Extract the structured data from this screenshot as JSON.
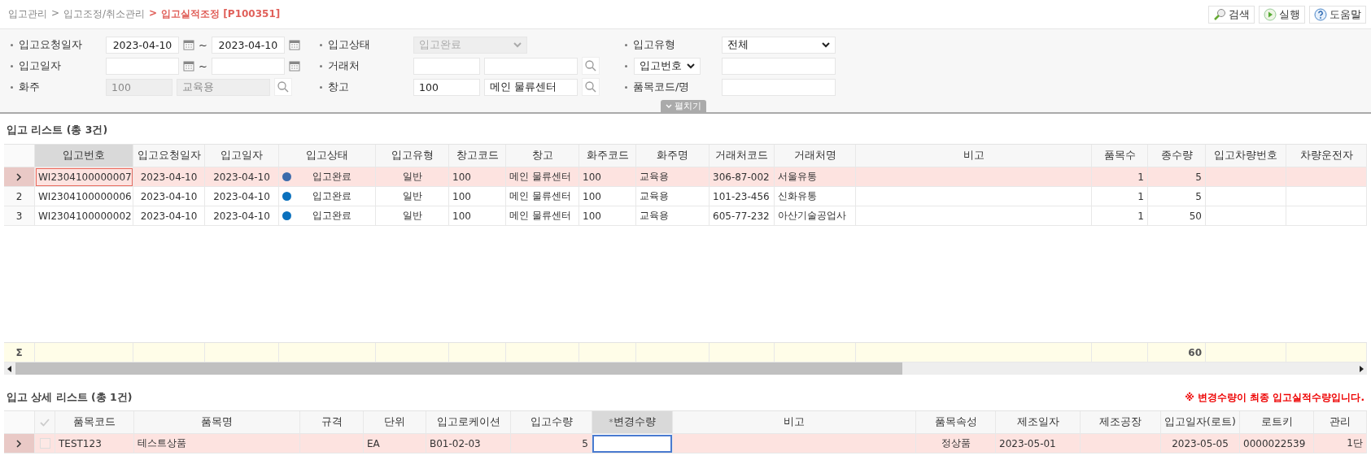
{
  "breadcrumb": {
    "separator": ">",
    "items": [
      {
        "label": "입고관리",
        "current": false
      },
      {
        "label": "입고조정/취소관리",
        "current": false
      },
      {
        "label": "입고실적조정 [P100351]",
        "current": true
      }
    ]
  },
  "toolbar": [
    {
      "kind": "search",
      "label": "검색"
    },
    {
      "kind": "run",
      "label": "실행"
    },
    {
      "kind": "help",
      "label": "도움말"
    }
  ],
  "filters": [
    [
      {
        "kind": "text",
        "label": "입고요청일자",
        "controls": [
          {
            "kind": "date",
            "value": "2023-04-10"
          },
          {
            "kind": "tilde",
            "text": "~"
          },
          {
            "kind": "date",
            "value": "2023-04-10"
          }
        ]
      },
      {
        "kind": "text",
        "label": "입고상태",
        "controls": [
          {
            "kind": "select",
            "value": "입고완료",
            "disabled": true
          }
        ]
      },
      {
        "kind": "text",
        "label": "입고유형",
        "controls": [
          {
            "kind": "select",
            "value": "전체",
            "disabled": false
          }
        ]
      }
    ],
    [
      {
        "kind": "text",
        "label": "입고일자",
        "controls": [
          {
            "kind": "date"
          },
          {
            "kind": "tilde",
            "text": "~"
          },
          {
            "kind": "date"
          }
        ]
      },
      {
        "kind": "text",
        "label": "거래처",
        "controls": [
          {
            "kind": "code-input",
            "disabled": false
          },
          {
            "kind": "name-input",
            "disabled": false
          },
          {
            "kind": "search"
          }
        ]
      },
      {
        "kind": "select",
        "label": "입고번호",
        "controls": [
          {
            "kind": "input",
            "disabled": false
          }
        ]
      }
    ],
    [
      {
        "kind": "text",
        "label": "화주",
        "controls": [
          {
            "kind": "code-input",
            "value": "100",
            "disabled": true
          },
          {
            "kind": "name-input",
            "value": "교육용",
            "disabled": true
          },
          {
            "kind": "search"
          }
        ]
      },
      {
        "kind": "text",
        "label": "창고",
        "controls": [
          {
            "kind": "code-input",
            "value": "100",
            "disabled": false
          },
          {
            "kind": "name-input",
            "value": "메인 물류센터",
            "disabled": false
          },
          {
            "kind": "search"
          }
        ]
      },
      {
        "kind": "text",
        "label": "품목코드/명",
        "controls": [
          {
            "kind": "input",
            "disabled": false
          }
        ]
      }
    ]
  ],
  "expand_tab": "펼치기",
  "list": {
    "title": "입고 리스트 (총 3건)",
    "columns": [
      {
        "label": "입고번호",
        "kind": "text",
        "active": true
      },
      {
        "label": "입고요청일자",
        "kind": "text",
        "active": false
      },
      {
        "label": "입고일자",
        "kind": "text",
        "active": false
      },
      {
        "label": "입고상태",
        "kind": "status",
        "active": false
      },
      {
        "label": "입고유형",
        "kind": "text",
        "active": false
      },
      {
        "label": "창고코드",
        "kind": "text",
        "active": false
      },
      {
        "label": "창고",
        "kind": "text",
        "active": false
      },
      {
        "label": "화주코드",
        "kind": "text",
        "active": false
      },
      {
        "label": "화주명",
        "kind": "text",
        "active": false
      },
      {
        "label": "거래처코드",
        "kind": "text",
        "active": false
      },
      {
        "label": "거래처명",
        "kind": "text",
        "active": false
      },
      {
        "label": "비고",
        "kind": "text",
        "active": false
      },
      {
        "label": "품목수",
        "kind": "text",
        "active": false
      },
      {
        "label": "종수량",
        "kind": "text",
        "active": false
      },
      {
        "label": "입고차량번호",
        "kind": "text",
        "active": false
      },
      {
        "label": "차량운전자",
        "kind": "text",
        "active": false
      }
    ],
    "rows": [
      {
        "selected": true,
        "first_cell_focused": true,
        "cells": [
          "WI2304100000007",
          "2023-04-10",
          "2023-04-10",
          "입고완료",
          "일반",
          "100",
          "메인 물류센터",
          "100",
          "교육용",
          "306-87-002",
          "서울유통",
          null,
          "1",
          "5",
          null,
          null
        ]
      },
      {
        "selected": false,
        "row_number": "2",
        "first_cell_focused": false,
        "cells": [
          "WI2304100000006",
          "2023-04-10",
          "2023-04-10",
          "입고완료",
          "일반",
          "100",
          "메인 물류센터",
          "100",
          "교육용",
          "101-23-456",
          "신화유통",
          null,
          "1",
          "5",
          null,
          null
        ]
      },
      {
        "selected": false,
        "row_number": "3",
        "first_cell_focused": false,
        "cells": [
          "WI2304100000002",
          "2023-04-10",
          "2023-04-10",
          "입고완료",
          "일반",
          "100",
          "메인 물류센터",
          "100",
          "교육용",
          "605-77-232",
          "아산기술공업사",
          null,
          "1",
          "50",
          null,
          null
        ]
      }
    ],
    "summary": {
      "label": "Σ",
      "cells": [
        null,
        null,
        null,
        null,
        null,
        null,
        null,
        null,
        null,
        null,
        null,
        null,
        null,
        "60",
        null,
        null
      ]
    }
  },
  "detail": {
    "title": "입고 상세 리스트 (총 1건)",
    "note": "※ 변경수량이 최종 입고실적수량입니다.",
    "columns": [
      {
        "label": "품목코드",
        "kind": "text",
        "active": false
      },
      {
        "label": "품목명",
        "kind": "text",
        "active": false
      },
      {
        "label": "규격",
        "kind": "text",
        "active": false
      },
      {
        "label": "단위",
        "kind": "text",
        "active": false
      },
      {
        "label": "입고로케이션",
        "kind": "text",
        "active": false
      },
      {
        "label": "입고수량",
        "kind": "text",
        "active": false
      },
      {
        "label": "변경수량",
        "kind": "edit",
        "active": true,
        "mark": "*"
      },
      {
        "label": "비고",
        "kind": "text",
        "active": false
      },
      {
        "label": "품목속성",
        "kind": "text",
        "active": false
      },
      {
        "label": "제조일자",
        "kind": "text",
        "active": false
      },
      {
        "label": "제조공장",
        "kind": "text",
        "active": false
      },
      {
        "label": "입고일자(로트)",
        "kind": "text",
        "active": false
      },
      {
        "label": "로트키",
        "kind": "text",
        "active": false
      },
      {
        "label": "관리",
        "kind": "text",
        "active": false
      }
    ],
    "rows": [
      {
        "selected": true,
        "checked": false,
        "editing": true,
        "cells": [
          "TEST123",
          "테스트상품",
          null,
          "EA",
          "B01-02-03",
          "5",
          null,
          null,
          "정상품",
          "2023-05-01",
          null,
          "2023-05-05",
          "0000022539",
          "1단"
        ]
      }
    ]
  }
}
